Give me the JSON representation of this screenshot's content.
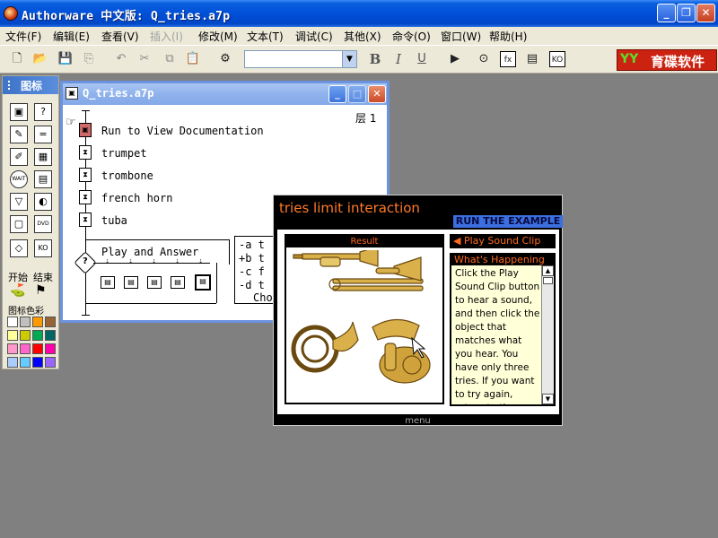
{
  "titlebar": {
    "title": "Authorware 中文版: Q_tries.a7p",
    "controls": {
      "minimize": "_",
      "maximize": "❐",
      "close": "✕"
    }
  },
  "menu": {
    "items": [
      {
        "label": "文件(F)"
      },
      {
        "label": "编辑(E)"
      },
      {
        "label": "查看(V)"
      },
      {
        "label": "插入(I)"
      },
      {
        "label": "修改(M)"
      },
      {
        "label": "文本(T)"
      },
      {
        "label": "调试(C)"
      },
      {
        "label": "其他(X)"
      },
      {
        "label": "命令(O)"
      },
      {
        "label": "窗口(W)"
      },
      {
        "label": "帮助(H)"
      }
    ]
  },
  "toolbar": {
    "font_value": "",
    "bold": "B",
    "italic": "I",
    "underline": "U",
    "brand_logo": "YY",
    "brand_text": "育碟软件"
  },
  "palette": {
    "title": "图标",
    "start": "开始",
    "end": "结束",
    "colors_label": "图标色彩",
    "icons": {
      "display": "▣",
      "motion": "?",
      "erase": "✎",
      "wait": "=",
      "navigate": "✐",
      "framework": "▦",
      "decision": "WAIT",
      "interaction": "▤",
      "calc": "▽",
      "map": "◐",
      "digital_movie": "▢",
      "sound": "DVD",
      "video": "◇",
      "knowledge": "KO"
    },
    "swatches": [
      "#ffffff",
      "#c0c0c0",
      "#ff9900",
      "#996633",
      "#ffff99",
      "#cccc00",
      "#00aa55",
      "#006666",
      "#ff99cc",
      "#ff66cc",
      "#ff0000",
      "#ff00aa",
      "#aaccff",
      "#66ccff",
      "#0000ff",
      "#9966ff"
    ]
  },
  "flowwin": {
    "title": "Q_tries.a7p",
    "level": "层 1",
    "items": [
      {
        "label": "Run to View Documentation"
      },
      {
        "label": "trumpet"
      },
      {
        "label": "trombone"
      },
      {
        "label": "french horn"
      },
      {
        "label": "tuba"
      }
    ],
    "interaction_label": "Play and Answer",
    "text_lines": [
      "-a t",
      "+b t",
      "-c f",
      "-d t",
      "Cho"
    ]
  },
  "pres": {
    "title": "tries limit interaction",
    "run_label": "RUN THE EXAMPLE",
    "result_label": "Result",
    "play_label": "◀ Play Sound Clip",
    "whats_header": "What's Happening",
    "whats_text": "Click the Play Sound Clip button to hear a sound, and then click the object that matches what you hear. You have only three tries. If you want to try again, return to the menu",
    "menu_label": "menu"
  }
}
